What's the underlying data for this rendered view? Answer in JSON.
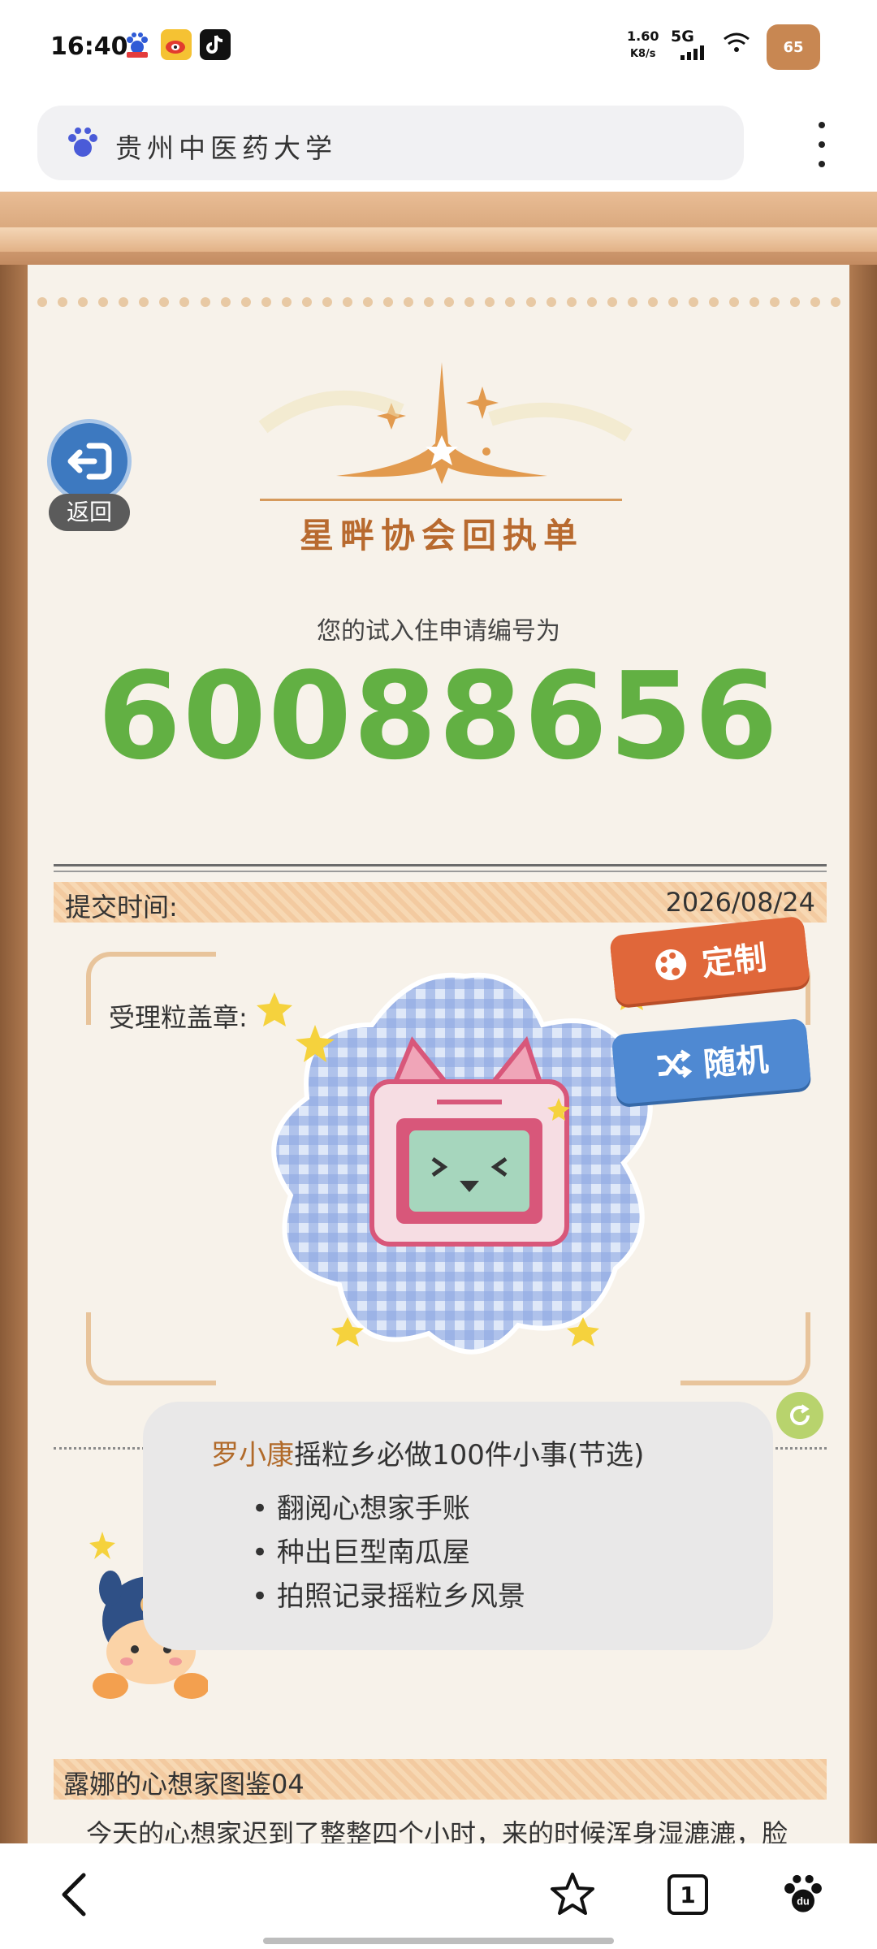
{
  "status_bar": {
    "time": "16:40",
    "net_speed_value": "1.60",
    "net_speed_unit": "K8/s",
    "network": "5G",
    "battery": "65",
    "app_icons": [
      "baidu-icon",
      "weibo-icon",
      "tiktok-icon"
    ]
  },
  "address_bar": {
    "text": "贵州中医药大学"
  },
  "page": {
    "logo_title": "星畔协会回执单",
    "back_label": "返回",
    "subtitle": "您的试入住申请编号为",
    "application_number": "60088656",
    "submit_label": "提交时间:",
    "submit_date": "2026/08/24",
    "stamp_label": "受理粒盖章:",
    "custom_button": "定制",
    "random_button": "随机",
    "todo": {
      "name": "罗小康",
      "title_rest": "摇粒乡必做100件小事(节选)",
      "items": [
        "翻阅心想家手账",
        "种出巨型南瓜屋",
        "拍照记录摇粒乡风景"
      ]
    },
    "section_title": "露娜的心想家图鉴04",
    "story_text": "今天的心想家迟到了整整四个小时，来的时候浑身湿漉漉，脸蛋边缘还沾着棕色的点点，看着有点像是泥。后来听猫头萝拉说，那孩子来的路上迷路迷到乌噜村，先是栽"
  },
  "bottom_nav": {
    "tab_count": "1"
  },
  "colors": {
    "number_green": "#62b043",
    "accent_orange": "#e0673a",
    "accent_blue": "#4f89d2",
    "logo_brown": "#b86a2f"
  }
}
